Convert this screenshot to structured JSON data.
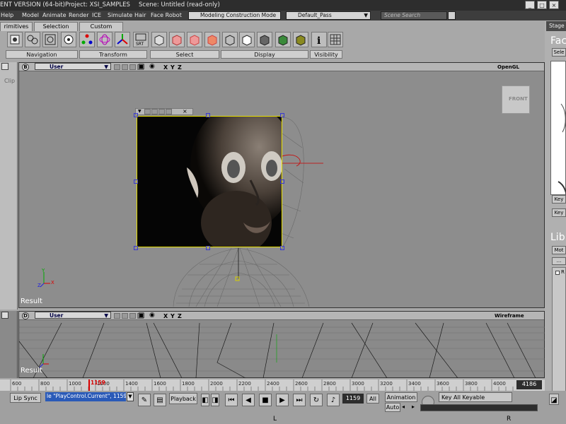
{
  "title_bar": {
    "version_text": "ENT VERSION (64-bit)",
    "project_text": "Project: XSI_SAMPLES",
    "scene_text": "Scene: Untitled (read-only)",
    "buttons": [
      "_",
      "□",
      "×"
    ]
  },
  "menu": {
    "items": [
      "Help",
      "Model",
      "Animate",
      "Render",
      "ICE",
      "Simulate",
      "Hair",
      "Face Robot"
    ],
    "mode_combo": "Modeling Construction Mode",
    "pass_combo": "Default_Pass",
    "search_placeholder": "Scene Search",
    "stage_tab": "Stage"
  },
  "tabs": [
    "rimitives",
    "Selection",
    "Custom"
  ],
  "toolbar_groups": [
    "Navigation",
    "Transform",
    "Select",
    "Display",
    "Visibility"
  ],
  "viewport_b": {
    "letter": "B",
    "camera": "User",
    "axes": [
      "X",
      "Y",
      "Z"
    ],
    "mode": "OpenGL",
    "cube_label": "FRONT",
    "result_label": "Result",
    "clip_label": "Clip"
  },
  "viewport_d": {
    "letter": "D",
    "camera": "User",
    "axes": [
      "X",
      "Y",
      "Z"
    ],
    "mode": "Wireframe",
    "result_label": "Result"
  },
  "right_panel": {
    "title": "Fac",
    "button_sel": "Sele",
    "key_1": "Key",
    "key_2": "Key",
    "lib_title": "Lib",
    "mot_tab": "Mot",
    "dots": "...",
    "checkbox_label": "R"
  },
  "timeline": {
    "ticks": [
      "600",
      "800",
      "1000",
      "1200",
      "1400",
      "1600",
      "1800",
      "2000",
      "2200",
      "2400",
      "2600",
      "2800",
      "3000",
      "3200",
      "3400",
      "3600",
      "3800",
      "4000"
    ],
    "current_frame_label": "1159",
    "end_frame": "4186"
  },
  "bottom": {
    "lip_sync": "Lip Sync",
    "command_text": "le \"PlayControl.Current\", 1159",
    "playback_label": "Playback",
    "frame_field": "1159",
    "all_btn": "All",
    "animation_btn": "Animation",
    "auto_btn": "Auto",
    "keyable_btn": "Key All Keyable",
    "bottom_marker_l": "L",
    "bottom_marker_r": "R"
  },
  "colors": {
    "selection_yellow": "#e8e000",
    "handle_blue": "#3a3ad0",
    "playhead_red": "#d80000"
  }
}
